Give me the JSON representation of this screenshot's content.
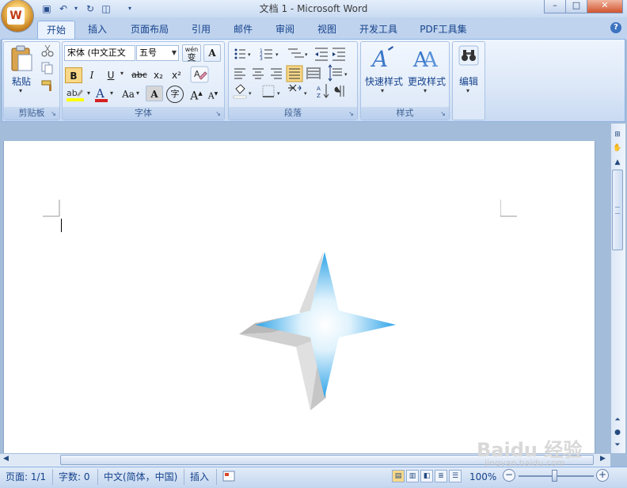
{
  "window": {
    "title": "文档 1 - Microsoft Word",
    "minimize": "–",
    "maximize": "□",
    "close": "✕"
  },
  "qat": {
    "save": "💾",
    "undo": "↶",
    "redo": "↻",
    "preview": "🔍",
    "more": "▾"
  },
  "tabs": [
    "开始",
    "插入",
    "页面布局",
    "引用",
    "邮件",
    "审阅",
    "视图",
    "开发工具",
    "PDF工具集"
  ],
  "help": "?",
  "ribbon": {
    "clipboard": {
      "label": "剪贴板",
      "paste": "粘贴"
    },
    "font": {
      "label": "字体",
      "font_name": "宋体 (中文正文",
      "font_size": "五号",
      "bold": "B",
      "italic": "I",
      "underline": "U",
      "strike": "abc",
      "subscript": "x₂",
      "superscript": "x²",
      "change_case": "Aa",
      "grow": "A",
      "shrink": "A",
      "wen": "wén",
      "bian": "变",
      "char_border": "A",
      "char_shading": "A",
      "enclose": "字"
    },
    "paragraph": {
      "label": "段落"
    },
    "styles": {
      "label": "样式",
      "quick": "快速样式",
      "change": "更改样式"
    },
    "editing": {
      "label": "编辑"
    }
  },
  "status": {
    "page": "页面: 1/1",
    "words": "字数: 0",
    "language": "中文(简体，中国)",
    "mode": "插入",
    "zoom": "100%",
    "zoom_level": 1.0
  },
  "watermark": {
    "brand": "Baidu 经验",
    "url": "jingyan.baidu.com"
  },
  "colors": {
    "star_blue": "#3aa6e6",
    "ribbon_bg": "#dbe7f7",
    "accent": "#15428b"
  }
}
